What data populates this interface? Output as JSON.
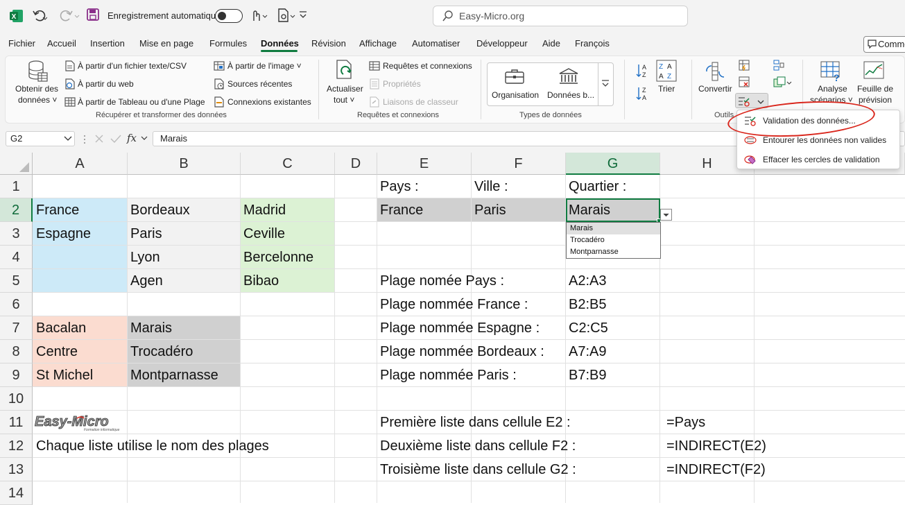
{
  "titlebar": {
    "autosave": "Enregistrement automatique",
    "search": "Easy-Micro.org"
  },
  "menu": {
    "items": [
      "Fichier",
      "Accueil",
      "Insertion",
      "Mise en page",
      "Formules",
      "Données",
      "Révision",
      "Affichage",
      "Automatiser",
      "Développeur",
      "Aide",
      "François"
    ],
    "comment": "Comme"
  },
  "ribbon": {
    "get_data": "Obtenir des",
    "get_data2": "données ˅",
    "from_text": "À partir d'un fichier texte/CSV",
    "from_web": "À partir du web",
    "from_table": "À partir de Tableau ou d'une Plage",
    "from_image": "À partir de l'image ˅",
    "recent": "Sources récentes",
    "existing": "Connexions existantes",
    "group1": "Récupérer et transformer des données",
    "refresh": "Actualiser",
    "refresh2": "tout ˅",
    "queries": "Requêtes et connexions",
    "properties": "Propriétés",
    "links": "Liaisons de classeur",
    "group2": "Requêtes et connexions",
    "organisation": "Organisation",
    "donnees_b": "Données b...",
    "group3": "Types de données",
    "trier": "Trier",
    "convertir": "Convertir",
    "outils": "Outils",
    "analyse": "Analyse",
    "scenarios": "scénarios ˅",
    "feuille": "Feuille de",
    "prevision": "prévision"
  },
  "dv_menu": [
    "Validation des données...",
    "Entourer les données non valides",
    "Effacer les cercles de validation"
  ],
  "formula": {
    "namebox": "G2",
    "content": "Marais"
  },
  "columns": [
    "A",
    "B",
    "C",
    "D",
    "E",
    "F",
    "G",
    "H"
  ],
  "rows": [
    "1",
    "2",
    "3",
    "4",
    "5",
    "6",
    "7",
    "8",
    "9",
    "10",
    "11",
    "12",
    "13",
    "14"
  ],
  "cells": {
    "E1": "Pays :",
    "F1": "Ville :",
    "G1": "Quartier :",
    "A2": "France",
    "B2": "Bordeaux",
    "C2": "Madrid",
    "E2": "France",
    "F2": "Paris",
    "G2": "Marais",
    "A3": "Espagne",
    "B3": "Paris",
    "C3": "Ceville",
    "B4": "Lyon",
    "C4": "Bercelonne",
    "B5": "Agen",
    "C5": "Bibao",
    "E5": "Plage nomée Pays :",
    "G5": "A2:A3",
    "E6": "Plage nommée France :",
    "G6": "B2:B5",
    "A7": "Bacalan",
    "B7": "Marais",
    "E7": "Plage nommée Espagne :",
    "G7": "C2:C5",
    "A8": "Centre",
    "B8": "Trocadéro",
    "E8": "Plage nommée Bordeaux :",
    "G8": "A7:A9",
    "A9": "St Michel",
    "B9": "Montparnasse",
    "E9": "Plage nommée Paris :",
    "G9": "B7:B9",
    "E11": "Première liste dans cellule E2 :",
    "H11": "=Pays",
    "A12": "Chaque liste utilise le nom des plages",
    "E12": "Deuxième liste dans cellule F2 :",
    "H12": "=INDIRECT(E2)",
    "E13": "Troisième liste dans cellule G2 :",
    "H13": "=INDIRECT(F2)"
  },
  "dropdown": [
    "Marais",
    "Trocadéro",
    "Montparnasse"
  ],
  "logo": {
    "main": "Easy-Micro",
    "sub": "Formation informatique"
  },
  "colors": {
    "blue": "#cdeaf8",
    "green": "#dcf2d4",
    "gray_light": "#f2f2f2",
    "salmon": "#fbdcd0",
    "gray": "#d0d0d0",
    "accent": "#107c41"
  }
}
